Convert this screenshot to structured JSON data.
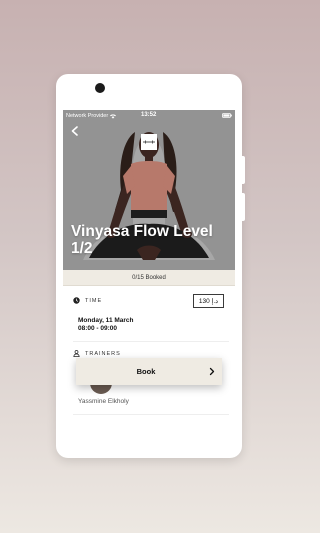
{
  "status_bar": {
    "carrier": "Network Provider",
    "time": "13:52",
    "wifi_icon": "wifi-icon",
    "battery_icon": "battery-icon"
  },
  "class": {
    "title": "Vinyasa Flow Level 1/2",
    "booked": "0/15 Booked"
  },
  "details": {
    "time_label": "TIME",
    "date": "Monday, 11 March",
    "hours": "08:00 - 09:00",
    "price": "130 د.إ",
    "trainers_label": "TRAINERS",
    "trainer_name": "Yassmine Elkholy"
  },
  "actions": {
    "back_icon": "chevron-left-icon",
    "book_label": "Book",
    "book_icon": "chevron-right-icon"
  },
  "colors": {
    "background_top": "#c7b1b1",
    "background_bottom": "#ede8e2",
    "accent_beige": "#efebe3",
    "hero_gray": "#939393"
  }
}
